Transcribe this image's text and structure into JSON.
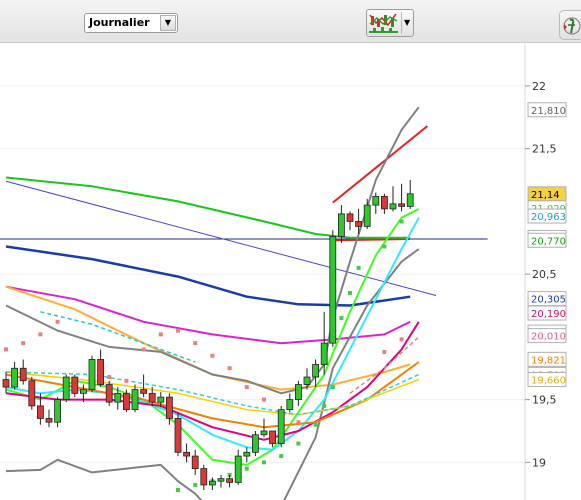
{
  "toolbar": {
    "period": "Journalier",
    "period_dropdown_icon": "triangle-down",
    "indicator_button_icon": "chart-indicators-icon",
    "indicator_dropdown_icon": "triangle-down",
    "side_button_icon": "function-icon"
  },
  "chart_data": {
    "type": "line",
    "y_axis_ticks": [
      "22",
      "21,5",
      "20,5",
      "19,5",
      "19"
    ],
    "y_range": [
      18.7,
      22.35
    ],
    "value_tags": [
      {
        "text": "21,810",
        "value": 21.81,
        "color": "#606060",
        "bg": "#ffffff"
      },
      {
        "text": "21,14",
        "value": 21.14,
        "color": "#000000",
        "bg": "#f5d040"
      },
      {
        "text": "21,029",
        "value": 21.029,
        "color": "#38c838",
        "bg": "#ffffff"
      },
      {
        "text": "20,963",
        "value": 20.963,
        "color": "#20a0c0",
        "bg": "#ffffff"
      },
      {
        "text": "20,792",
        "value": 20.792,
        "color": "#18a018",
        "bg": "#ffffff"
      },
      {
        "text": "20,770",
        "value": 20.77,
        "color": "#18a018",
        "bg": "#ffffff"
      },
      {
        "text": "20,305",
        "value": 20.305,
        "color": "#1a3ca8",
        "bg": "#ffffff"
      },
      {
        "text": "20,190",
        "value": 20.19,
        "color": "#d01070",
        "bg": "#ffffff"
      },
      {
        "text": "20,038",
        "value": 20.038,
        "color": "#e020c0",
        "bg": "#ffffff"
      },
      {
        "text": "20,010",
        "value": 20.01,
        "color": "#e06080",
        "bg": "#ffffff"
      },
      {
        "text": "19,821",
        "value": 19.821,
        "color": "#f08000",
        "bg": "#ffffff"
      },
      {
        "text": "19,701",
        "value": 19.701,
        "color": "#30b0b0",
        "bg": "#ffffff"
      },
      {
        "text": "19,660",
        "value": 19.66,
        "color": "#e0b000",
        "bg": "#ffffff"
      }
    ],
    "candles": [
      [
        19.66,
        19.72,
        19.55,
        19.6
      ],
      [
        19.6,
        19.8,
        19.58,
        19.75
      ],
      [
        19.75,
        19.82,
        19.62,
        19.65
      ],
      [
        19.65,
        19.68,
        19.42,
        19.45
      ],
      [
        19.45,
        19.55,
        19.3,
        19.35
      ],
      [
        19.35,
        19.42,
        19.28,
        19.32
      ],
      [
        19.32,
        19.52,
        19.28,
        19.5
      ],
      [
        19.5,
        19.7,
        19.48,
        19.68
      ],
      [
        19.68,
        19.7,
        19.52,
        19.55
      ],
      [
        19.55,
        19.62,
        19.48,
        19.58
      ],
      [
        19.58,
        19.85,
        19.56,
        19.82
      ],
      [
        19.82,
        19.9,
        19.6,
        19.62
      ],
      [
        19.62,
        19.65,
        19.45,
        19.48
      ],
      [
        19.48,
        19.6,
        19.42,
        19.55
      ],
      [
        19.55,
        19.58,
        19.4,
        19.42
      ],
      [
        19.42,
        19.62,
        19.4,
        19.58
      ],
      [
        19.58,
        19.7,
        19.52,
        19.55
      ],
      [
        19.55,
        19.6,
        19.45,
        19.48
      ],
      [
        19.48,
        19.56,
        19.44,
        19.52
      ],
      [
        19.52,
        19.55,
        19.3,
        19.35
      ],
      [
        19.35,
        19.4,
        19.05,
        19.08
      ],
      [
        19.08,
        19.15,
        19.0,
        19.05
      ],
      [
        19.05,
        19.1,
        18.9,
        18.95
      ],
      [
        18.95,
        18.98,
        18.78,
        18.82
      ],
      [
        18.82,
        18.88,
        18.78,
        18.85
      ],
      [
        18.85,
        18.9,
        18.8,
        18.87
      ],
      [
        18.87,
        18.9,
        18.8,
        18.84
      ],
      [
        18.84,
        19.1,
        18.82,
        19.05
      ],
      [
        19.05,
        19.12,
        19.0,
        19.08
      ],
      [
        19.08,
        19.25,
        19.05,
        19.22
      ],
      [
        19.22,
        19.35,
        19.2,
        19.25
      ],
      [
        19.25,
        19.2,
        19.12,
        19.15
      ],
      [
        19.15,
        19.45,
        19.12,
        19.42
      ],
      [
        19.42,
        19.55,
        19.4,
        19.5
      ],
      [
        19.5,
        19.65,
        19.45,
        19.62
      ],
      [
        19.62,
        19.75,
        19.58,
        19.68
      ],
      [
        19.68,
        19.82,
        19.6,
        19.78
      ],
      [
        19.78,
        20.2,
        19.7,
        19.95
      ],
      [
        19.95,
        20.85,
        19.92,
        20.8
      ],
      [
        20.8,
        21.05,
        20.75,
        20.98
      ],
      [
        20.98,
        21.0,
        20.85,
        20.92
      ],
      [
        20.92,
        21.02,
        20.82,
        20.88
      ],
      [
        20.88,
        21.1,
        20.86,
        21.05
      ],
      [
        21.05,
        21.15,
        20.98,
        21.12
      ],
      [
        21.12,
        21.14,
        20.98,
        21.02
      ],
      [
        21.02,
        21.2,
        21.0,
        21.06
      ],
      [
        21.06,
        21.22,
        21.0,
        21.04
      ],
      [
        21.04,
        21.25,
        21.02,
        21.14
      ]
    ],
    "trendlines": {
      "support": [
        [
          0,
          20.78
        ],
        [
          47,
          20.78
        ]
      ],
      "descending": [
        [
          0,
          21.24
        ],
        [
          50,
          20.33
        ]
      ],
      "channel_upper": [
        [
          38,
          21.07
        ],
        [
          49,
          21.68
        ]
      ],
      "channel_lower": [
        [
          38,
          20.77
        ],
        [
          47,
          20.78
        ]
      ]
    },
    "moving_averages": [
      {
        "color": "#18c818",
        "width": 2,
        "dash": "",
        "values": [
          [
            0,
            21.27
          ],
          [
            10,
            21.2
          ],
          [
            20,
            21.08
          ],
          [
            30,
            20.92
          ],
          [
            36,
            20.82
          ],
          [
            40,
            20.79
          ],
          [
            47,
            20.79
          ]
        ]
      },
      {
        "color": "#1a3ca8",
        "width": 2.5,
        "dash": "",
        "values": [
          [
            0,
            20.72
          ],
          [
            10,
            20.62
          ],
          [
            20,
            20.48
          ],
          [
            28,
            20.32
          ],
          [
            34,
            20.26
          ],
          [
            40,
            20.25
          ],
          [
            47,
            20.32
          ]
        ]
      },
      {
        "color": "#e020d0",
        "width": 2,
        "dash": "",
        "values": [
          [
            0,
            20.4
          ],
          [
            8,
            20.3
          ],
          [
            16,
            20.12
          ],
          [
            24,
            20.02
          ],
          [
            32,
            19.95
          ],
          [
            38,
            19.98
          ],
          [
            44,
            20.02
          ],
          [
            47,
            20.12
          ]
        ]
      },
      {
        "color": "#ffb030",
        "width": 2,
        "dash": "",
        "values": [
          [
            0,
            20.4
          ],
          [
            8,
            20.22
          ],
          [
            16,
            19.95
          ],
          [
            24,
            19.7
          ],
          [
            32,
            19.58
          ],
          [
            38,
            19.62
          ],
          [
            44,
            19.72
          ],
          [
            47,
            19.78
          ]
        ]
      },
      {
        "color": "#808080",
        "width": 2,
        "dash": "",
        "values": [
          [
            0,
            20.25
          ],
          [
            6,
            20.05
          ],
          [
            12,
            19.92
          ],
          [
            18,
            19.88
          ],
          [
            24,
            19.7
          ],
          [
            28,
            19.65
          ],
          [
            32,
            19.55
          ],
          [
            35,
            19.6
          ],
          [
            37,
            19.78
          ],
          [
            38,
            20.15
          ],
          [
            40,
            20.6
          ],
          [
            43,
            21.25
          ],
          [
            46,
            21.65
          ],
          [
            48,
            21.83
          ]
        ]
      },
      {
        "color": "#808080",
        "width": 2,
        "dash": "",
        "values": [
          [
            0,
            18.93
          ],
          [
            4,
            18.94
          ],
          [
            6,
            19.02
          ],
          [
            10,
            18.92
          ],
          [
            14,
            18.95
          ],
          [
            18,
            18.98
          ],
          [
            20,
            18.85
          ],
          [
            22,
            18.75
          ],
          [
            24,
            18.6
          ],
          [
            28,
            18.5
          ],
          [
            32,
            18.65
          ],
          [
            36,
            19.2
          ],
          [
            38,
            19.75
          ],
          [
            42,
            20.25
          ],
          [
            46,
            20.6
          ],
          [
            48,
            20.7
          ]
        ]
      },
      {
        "color": "#40ff20",
        "width": 2,
        "dash": "",
        "values": [
          [
            0,
            19.58
          ],
          [
            4,
            19.5
          ],
          [
            8,
            19.65
          ],
          [
            12,
            19.6
          ],
          [
            16,
            19.5
          ],
          [
            20,
            19.3
          ],
          [
            24,
            19.02
          ],
          [
            28,
            18.98
          ],
          [
            31,
            19.1
          ],
          [
            34,
            19.4
          ],
          [
            37,
            19.7
          ],
          [
            40,
            20.2
          ],
          [
            43,
            20.65
          ],
          [
            46,
            20.95
          ],
          [
            48,
            21.02
          ]
        ]
      },
      {
        "color": "#30e8ff",
        "width": 2,
        "dash": "",
        "values": [
          [
            0,
            19.6
          ],
          [
            4,
            19.55
          ],
          [
            8,
            19.58
          ],
          [
            12,
            19.55
          ],
          [
            16,
            19.48
          ],
          [
            20,
            19.38
          ],
          [
            24,
            19.22
          ],
          [
            28,
            19.12
          ],
          [
            31,
            19.1
          ],
          [
            34,
            19.25
          ],
          [
            37,
            19.5
          ],
          [
            40,
            19.9
          ],
          [
            43,
            20.3
          ],
          [
            46,
            20.7
          ],
          [
            48,
            20.95
          ]
        ]
      },
      {
        "color": "#e00080",
        "width": 2,
        "dash": "",
        "values": [
          [
            0,
            19.55
          ],
          [
            6,
            19.5
          ],
          [
            12,
            19.5
          ],
          [
            18,
            19.45
          ],
          [
            24,
            19.28
          ],
          [
            30,
            19.18
          ],
          [
            34,
            19.25
          ],
          [
            38,
            19.4
          ],
          [
            42,
            19.6
          ],
          [
            46,
            19.9
          ],
          [
            48,
            20.12
          ]
        ]
      },
      {
        "color": "#f08000",
        "width": 2,
        "dash": "",
        "values": [
          [
            0,
            19.7
          ],
          [
            8,
            19.6
          ],
          [
            16,
            19.5
          ],
          [
            24,
            19.35
          ],
          [
            30,
            19.28
          ],
          [
            36,
            19.32
          ],
          [
            42,
            19.5
          ],
          [
            48,
            19.8
          ]
        ]
      },
      {
        "color": "#ffcc00",
        "width": 1.5,
        "dash": "",
        "values": [
          [
            0,
            19.72
          ],
          [
            10,
            19.65
          ],
          [
            20,
            19.55
          ],
          [
            28,
            19.42
          ],
          [
            34,
            19.38
          ],
          [
            40,
            19.45
          ],
          [
            48,
            19.66
          ]
        ]
      },
      {
        "color": "#30d0d0",
        "width": 1.5,
        "dash": "4,3",
        "values": [
          [
            0,
            19.72
          ],
          [
            10,
            19.7
          ],
          [
            20,
            19.58
          ],
          [
            28,
            19.45
          ],
          [
            34,
            19.38
          ],
          [
            40,
            19.45
          ],
          [
            48,
            19.7
          ]
        ]
      },
      {
        "color": "#20c8c8",
        "width": 1.5,
        "dash": "4,3",
        "values": [
          [
            4,
            20.2
          ],
          [
            10,
            20.1
          ],
          [
            16,
            19.95
          ],
          [
            22,
            19.8
          ]
        ]
      },
      {
        "color": "#e08080",
        "width": 1.5,
        "dash": "4,3",
        "values": [
          [
            40,
            19.55
          ],
          [
            44,
            19.75
          ],
          [
            48,
            20.0
          ]
        ]
      }
    ],
    "dots_green": [
      [
        20,
        18.78
      ],
      [
        22,
        18.82
      ],
      [
        24,
        18.85
      ],
      [
        26,
        18.9
      ],
      [
        28,
        18.95
      ],
      [
        30,
        19.0
      ],
      [
        32,
        19.05
      ],
      [
        34,
        19.15
      ],
      [
        36,
        19.3
      ],
      [
        37,
        19.45
      ],
      [
        38,
        19.6
      ],
      [
        39,
        20.15
      ],
      [
        40,
        20.35
      ],
      [
        41,
        20.55
      ],
      [
        44,
        20.72
      ],
      [
        46,
        20.92
      ]
    ],
    "dots_red": [
      [
        0,
        19.9
      ],
      [
        2,
        19.95
      ],
      [
        4,
        20.02
      ],
      [
        6,
        20.12
      ],
      [
        10,
        19.7
      ],
      [
        12,
        19.68
      ],
      [
        14,
        19.65
      ],
      [
        16,
        19.9
      ],
      [
        18,
        20.02
      ],
      [
        20,
        20.05
      ],
      [
        22,
        19.95
      ],
      [
        24,
        19.85
      ],
      [
        26,
        19.75
      ],
      [
        28,
        19.6
      ],
      [
        30,
        19.5
      ],
      [
        32,
        19.4
      ],
      [
        34,
        19.32
      ],
      [
        44,
        19.88
      ],
      [
        46,
        19.98
      ]
    ]
  }
}
